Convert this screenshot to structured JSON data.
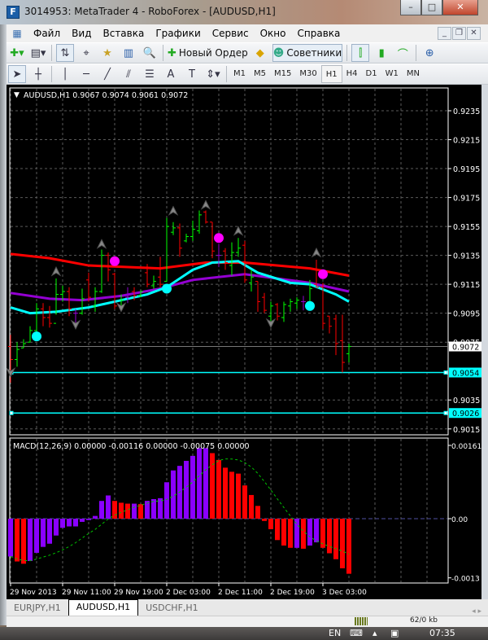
{
  "window": {
    "title": "3014953: MetaTrader 4 - RoboForex - [AUDUSD,H1]",
    "minimize": "–",
    "maximize": "□",
    "close": "✕"
  },
  "menu": [
    "Файл",
    "Вид",
    "Вставка",
    "Графики",
    "Сервис",
    "Окно",
    "Справка"
  ],
  "toolbar": {
    "new_order": "Новый Ордер",
    "experts": "Советники"
  },
  "timeframes": [
    "M1",
    "M5",
    "M15",
    "M30",
    "H1",
    "H4",
    "D1",
    "W1",
    "MN"
  ],
  "active_timeframe": "H1",
  "chart": {
    "header": "AUDUSD,H1  0.9067 0.9074 0.9061 0.9072",
    "price_ticks": [
      "0.9235",
      "0.9215",
      "0.9195",
      "0.9175",
      "0.9155",
      "0.9135",
      "0.9115",
      "0.9095",
      "0.9075",
      "0.9035",
      "0.9015"
    ],
    "bid_label": "0.9072",
    "bid": 0.9072,
    "hlines": [
      {
        "price": 0.9054,
        "label": "0.9054"
      },
      {
        "price": 0.9026,
        "label": "0.9026"
      }
    ],
    "colors": {
      "bull": "#00ff00",
      "bear": "#ff0000",
      "doji": "#9400d3",
      "red_ma": "#ff0000",
      "purple_ma": "#9400d3",
      "cyan_ma": "#00ffff",
      "buy_dot": "#00ffff",
      "sell_dot": "#ff00ff",
      "hline": "#00ffff"
    },
    "ohlc": [
      [
        0.9072,
        0.908,
        0.9047,
        0.9063
      ],
      [
        0.9063,
        0.9075,
        0.9058,
        0.907
      ],
      [
        0.9071,
        0.9077,
        0.9071,
        0.9074
      ],
      [
        0.9075,
        0.9086,
        0.9075,
        0.9083
      ],
      [
        0.9083,
        0.9102,
        0.9079,
        0.9098
      ],
      [
        0.9098,
        0.9102,
        0.9086,
        0.9092
      ],
      [
        0.9092,
        0.91,
        0.9085,
        0.9088
      ],
      [
        0.9088,
        0.9119,
        0.9094,
        0.9108
      ],
      [
        0.9108,
        0.9114,
        0.9103,
        0.911
      ],
      [
        0.911,
        0.9113,
        0.9093,
        0.9098
      ],
      [
        0.9095,
        0.9098,
        0.9085,
        0.9095
      ],
      [
        0.9095,
        0.9112,
        0.9094,
        0.9105
      ],
      [
        0.9118,
        0.9123,
        0.9103,
        0.9106
      ],
      [
        0.91,
        0.9113,
        0.9096,
        0.911
      ],
      [
        0.911,
        0.9139,
        0.9109,
        0.9135
      ],
      [
        0.9135,
        0.9137,
        0.9117,
        0.9125
      ],
      [
        0.9122,
        0.9123,
        0.9098,
        0.91
      ],
      [
        0.91,
        0.9108,
        0.9097,
        0.9104
      ],
      [
        0.9106,
        0.9113,
        0.9102,
        0.9106
      ],
      [
        0.911,
        0.9113,
        0.9104,
        0.9107
      ],
      [
        0.9107,
        0.9111,
        0.9106,
        0.911
      ],
      [
        0.9123,
        0.9129,
        0.9113,
        0.9115
      ],
      [
        0.9114,
        0.9121,
        0.9112,
        0.9117
      ],
      [
        0.912,
        0.9134,
        0.9113,
        0.9115
      ],
      [
        0.9117,
        0.9161,
        0.9117,
        0.9155
      ],
      [
        0.9151,
        0.9158,
        0.9149,
        0.9154
      ],
      [
        0.9154,
        0.9157,
        0.9134,
        0.914
      ],
      [
        0.9145,
        0.915,
        0.9144,
        0.9148
      ],
      [
        0.9148,
        0.9159,
        0.9145,
        0.9153
      ],
      [
        0.9152,
        0.9166,
        0.915,
        0.9163
      ],
      [
        0.9165,
        0.9166,
        0.9157,
        0.9158
      ],
      [
        0.9158,
        0.9158,
        0.9133,
        0.9138
      ],
      [
        0.9135,
        0.9143,
        0.9127,
        0.9135
      ],
      [
        0.9138,
        0.914,
        0.9125,
        0.913
      ],
      [
        0.9128,
        0.9144,
        0.9121,
        0.9137
      ],
      [
        0.9137,
        0.9147,
        0.9134,
        0.914
      ],
      [
        0.9142,
        0.9145,
        0.9116,
        0.9118
      ],
      [
        0.9116,
        0.9125,
        0.911,
        0.912
      ],
      [
        0.9117,
        0.9117,
        0.9096,
        0.9103
      ],
      [
        0.9106,
        0.9109,
        0.9095,
        0.9097
      ],
      [
        0.9093,
        0.9103,
        0.9088,
        0.91
      ],
      [
        0.9101,
        0.9102,
        0.909,
        0.9093
      ],
      [
        0.9092,
        0.9103,
        0.9089,
        0.9101
      ],
      [
        0.91,
        0.9105,
        0.9096,
        0.9103
      ],
      [
        0.9102,
        0.9106,
        0.9098,
        0.9104
      ],
      [
        0.9103,
        0.9107,
        0.9097,
        0.9103
      ],
      [
        0.9103,
        0.9118,
        0.9103,
        0.9112
      ],
      [
        0.9115,
        0.9132,
        0.9113,
        0.9113
      ],
      [
        0.9113,
        0.9116,
        0.9084,
        0.9088
      ],
      [
        0.9093,
        0.9093,
        0.9081,
        0.9086
      ],
      [
        0.9091,
        0.9094,
        0.9066,
        0.9074
      ],
      [
        0.9076,
        0.9094,
        0.9054,
        0.9061
      ],
      [
        0.9067,
        0.9074,
        0.9061,
        0.9072
      ]
    ],
    "red_ma": [
      [
        0,
        0.9136
      ],
      [
        6,
        0.9133
      ],
      [
        12,
        0.9128
      ],
      [
        23,
        0.9126
      ],
      [
        30,
        0.913
      ],
      [
        36,
        0.913
      ],
      [
        46,
        0.9126
      ],
      [
        52,
        0.9121
      ]
    ],
    "purple_ma": [
      [
        0,
        0.9109
      ],
      [
        6,
        0.9105
      ],
      [
        11,
        0.9104
      ],
      [
        17,
        0.9107
      ],
      [
        23,
        0.9112
      ],
      [
        28,
        0.9118
      ],
      [
        36,
        0.9122
      ],
      [
        46,
        0.9116
      ],
      [
        52,
        0.911
      ]
    ],
    "cyan_ma": [
      [
        0,
        0.9099
      ],
      [
        3,
        0.9095
      ],
      [
        7,
        0.9096
      ],
      [
        12,
        0.9099
      ],
      [
        17,
        0.9104
      ],
      [
        21,
        0.9108
      ],
      [
        24,
        0.9113
      ],
      [
        28,
        0.9125
      ],
      [
        31,
        0.913
      ],
      [
        35,
        0.9131
      ],
      [
        38,
        0.9123
      ],
      [
        43,
        0.9116
      ],
      [
        46,
        0.9115
      ],
      [
        50,
        0.9108
      ],
      [
        52,
        0.9103
      ]
    ],
    "buy_dots": [
      [
        4,
        0.9079
      ],
      [
        24,
        0.9112
      ],
      [
        46,
        0.91
      ]
    ],
    "sell_dots": [
      [
        16,
        0.9131
      ],
      [
        32,
        0.9147
      ],
      [
        48,
        0.9122
      ]
    ],
    "up_arrows": [
      [
        7,
        0.9124
      ],
      [
        14,
        0.9143
      ],
      [
        25,
        0.9166
      ],
      [
        30,
        0.917
      ],
      [
        35,
        0.9152
      ],
      [
        47,
        0.9137
      ]
    ],
    "down_arrows": [
      [
        10,
        0.9087
      ],
      [
        17,
        0.9099
      ],
      [
        40,
        0.9088
      ],
      [
        0,
        0.9054
      ]
    ]
  },
  "macd": {
    "header": "MACD(12,26,9) 0.00000 -0.00116 0.00000 -0.00075 0.00000",
    "ticks": [
      "0.00161",
      "0.00",
      "-0.0013"
    ],
    "bars": [
      -0.00083,
      -0.00094,
      -0.00099,
      -0.00093,
      -0.00075,
      -0.00062,
      -0.00055,
      -0.00037,
      -0.0002,
      -0.00017,
      -0.00017,
      -7e-05,
      -3e-05,
      6e-05,
      0.00039,
      0.00051,
      0.00039,
      0.00035,
      0.00033,
      0.00033,
      0.00032,
      0.00039,
      0.00043,
      0.00045,
      0.0008,
      0.00106,
      0.00116,
      0.00127,
      0.00138,
      0.00155,
      0.00155,
      0.00144,
      0.00129,
      0.00112,
      0.00103,
      0.00099,
      0.00073,
      0.00052,
      0.00028,
      -5e-05,
      -0.00023,
      -0.00047,
      -0.00059,
      -0.00064,
      -0.00064,
      -0.00066,
      -0.00059,
      -0.00052,
      -0.00064,
      -0.00076,
      -0.00089,
      -0.00109,
      -0.00121
    ],
    "colors": {
      "up": "#8a00ff",
      "down": "#ff0000",
      "signal": "#00c000"
    }
  },
  "time_labels": [
    "29 Nov 2013",
    "29 Nov 11:00",
    "29 Nov 19:00",
    "2 Dec 03:00",
    "2 Dec 11:00",
    "2 Dec 19:00",
    "3 Dec 03:00"
  ],
  "tabs": [
    {
      "label": "EURJPY,H1"
    },
    {
      "label": "AUDUSD,H1",
      "active": true
    },
    {
      "label": "USDCHF,H1"
    }
  ],
  "status": {
    "traffic": "62/0 kb"
  },
  "taskbar": {
    "lang": "EN",
    "time": "07:35"
  }
}
